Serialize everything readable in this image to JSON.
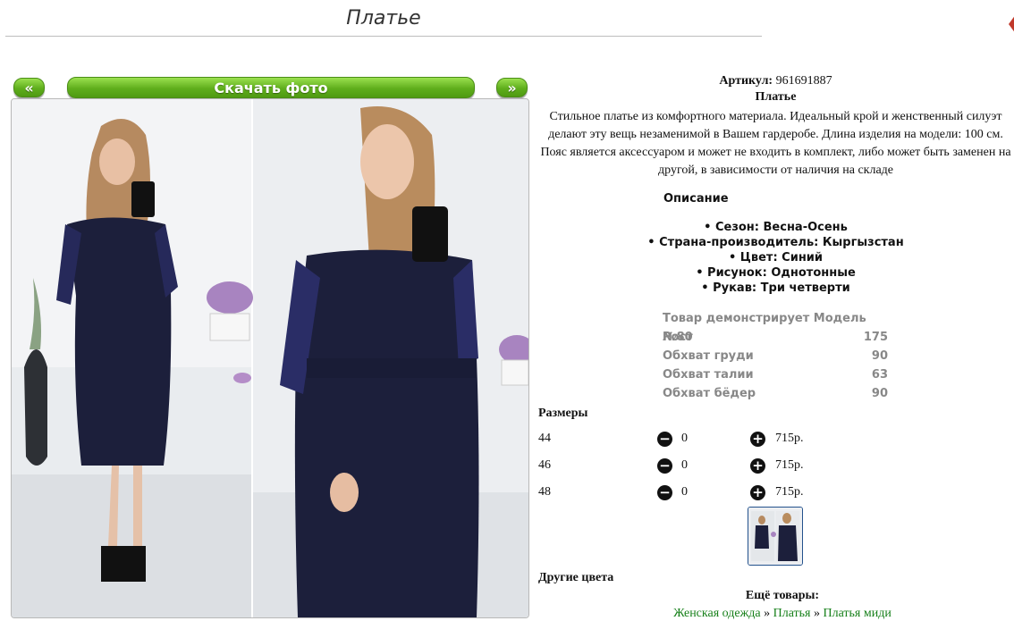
{
  "page": {
    "title": "Платье"
  },
  "gallery": {
    "prev_label": "«",
    "download_label": "Скачать фото",
    "next_label": "»"
  },
  "product": {
    "article_label": "Артикул:",
    "article_value": "961691887",
    "name": "Платье",
    "description": "Стильное платье из комфортного материала. Идеальный крой и женственный силуэт делают эту вещь незаменимой в Вашем гардеробе. Длина изделия на модели: 100 см. Пояс является аксессуаром и может не входить в комплект, либо может быть заменен на другой, в зависимости от наличия на складе",
    "description_heading": "Описание",
    "features": [
      "• Сезон: Весна-Осень",
      "• Страна-производитель: Кыргызстан",
      "• Цвет: Синий",
      "• Рисунок: Однотонные",
      "• Рукав: Три четверти"
    ]
  },
  "model": {
    "heading": "Товар демонстрирует Модель №80",
    "rows": [
      {
        "label": "Рост",
        "value": "175"
      },
      {
        "label": "Обхват груди",
        "value": "90"
      },
      {
        "label": "Обхват талии",
        "value": "63"
      },
      {
        "label": "Обхват бёдер",
        "value": "90"
      }
    ]
  },
  "sizes": {
    "heading": "Размеры",
    "rows": [
      {
        "size": "44",
        "qty": "0",
        "price": "715р."
      },
      {
        "size": "46",
        "qty": "0",
        "price": "715р."
      },
      {
        "size": "48",
        "qty": "0",
        "price": "715р."
      }
    ]
  },
  "other_colors_heading": "Другие цвета",
  "more_goods_heading": "Ещё товары:",
  "breadcrumbs": [
    "Женская одежда",
    "Платья",
    "Платья миди"
  ],
  "breadcrumb_separator": "»",
  "colors": {
    "button_green": "#5fae1c",
    "link_green": "#17801a",
    "dress_navy": "#1c1f3b"
  }
}
